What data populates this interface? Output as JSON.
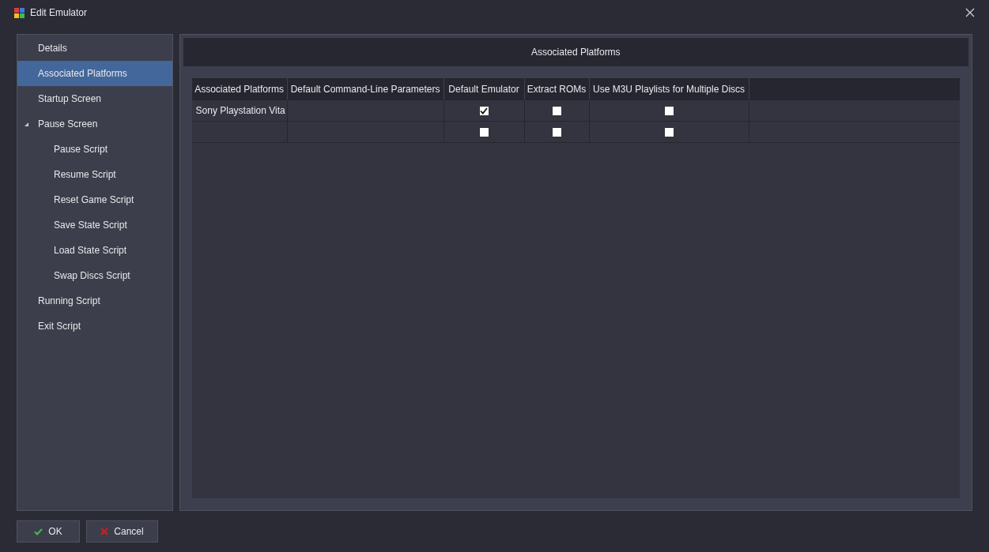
{
  "window": {
    "title": "Edit Emulator"
  },
  "sidebar": {
    "items": [
      {
        "label": "Details",
        "selected": false
      },
      {
        "label": "Associated Platforms",
        "selected": true
      },
      {
        "label": "Startup Screen",
        "selected": false
      },
      {
        "label": "Pause Screen",
        "selected": false,
        "expanded": true,
        "children": [
          {
            "label": "Pause Script",
            "selected": false
          },
          {
            "label": "Resume Script",
            "selected": false
          },
          {
            "label": "Reset Game Script",
            "selected": false
          },
          {
            "label": "Save State Script",
            "selected": false
          },
          {
            "label": "Load State Script",
            "selected": false
          },
          {
            "label": "Swap Discs Script",
            "selected": false
          }
        ]
      },
      {
        "label": "Running Script",
        "selected": false
      },
      {
        "label": "Exit Script",
        "selected": false
      }
    ]
  },
  "panel": {
    "title": "Associated Platforms",
    "table": {
      "columns": [
        "Associated Platforms",
        "Default Command-Line Parameters",
        "Default Emulator",
        "Extract ROMs",
        "Use M3U Playlists for Multiple Discs"
      ],
      "rows": [
        {
          "platform": "Sony Playstation Vita",
          "default_emulator": true,
          "extract_roms": false,
          "use_m3u": false
        },
        {
          "default_emulator": false,
          "extract_roms": false,
          "use_m3u": false
        }
      ]
    }
  },
  "buttons": [
    {
      "kind": "ok",
      "label": "OK"
    },
    {
      "kind": "cancel",
      "label": "Cancel"
    }
  ]
}
